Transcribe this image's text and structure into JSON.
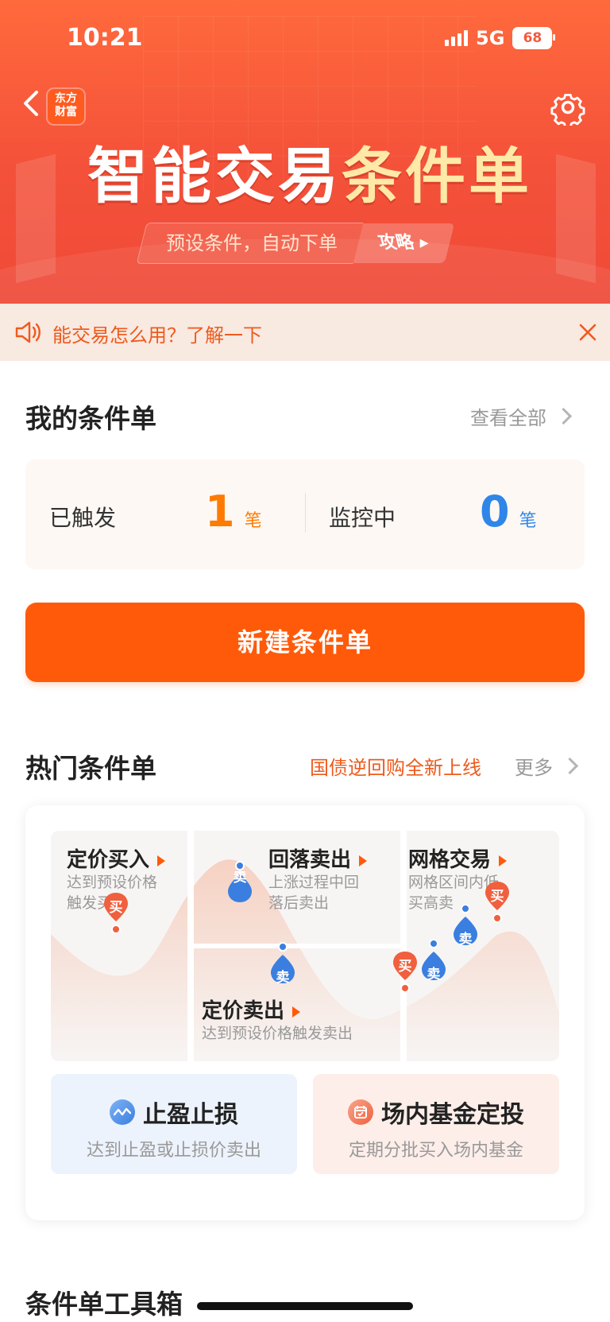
{
  "status_bar": {
    "time": "10:21",
    "network": "5G",
    "battery": "68"
  },
  "header": {
    "logo_line1": "东方",
    "logo_line2": "财富",
    "title_main": "智能交易",
    "title_highlight": "条件单",
    "subtitle": "预设条件，自动下单",
    "guide_label": "攻略"
  },
  "notice": {
    "text": "能交易怎么用？了解一下"
  },
  "my_orders": {
    "title": "我的条件单",
    "view_all": "查看全部",
    "triggered_label": "已触发",
    "triggered_count": "1",
    "monitoring_label": "监控中",
    "monitoring_count": "0",
    "unit": "笔"
  },
  "new_button": "新建条件单",
  "hot": {
    "title": "热门条件单",
    "promo": "国债逆回购全新上线",
    "more": "更多",
    "tiles": {
      "fixed_buy": {
        "title": "定价买入",
        "desc_line1": "达到预设价格",
        "desc_line2": "触发买入"
      },
      "pullback_sell": {
        "title": "回落卖出",
        "desc_line1": "上涨过程中回",
        "desc_line2": "落后卖出"
      },
      "grid": {
        "title": "网格交易",
        "desc_line1": "网格区间内低",
        "desc_line2": "买高卖"
      },
      "fixed_sell": {
        "title": "定价卖出",
        "desc": "达到预设价格触发卖出"
      }
    },
    "pins": {
      "buy": "买",
      "sell": "卖"
    },
    "stop": {
      "title": "止盈止损",
      "desc": "达到止盈或止损价卖出"
    },
    "fund": {
      "title": "场内基金定投",
      "desc": "定期分批买入场内基金"
    }
  },
  "toolbox": {
    "title": "条件单工具箱"
  },
  "colors": {
    "accent": "#ff5a0a",
    "buy": "#f0603e",
    "sell": "#3a7fe0"
  }
}
